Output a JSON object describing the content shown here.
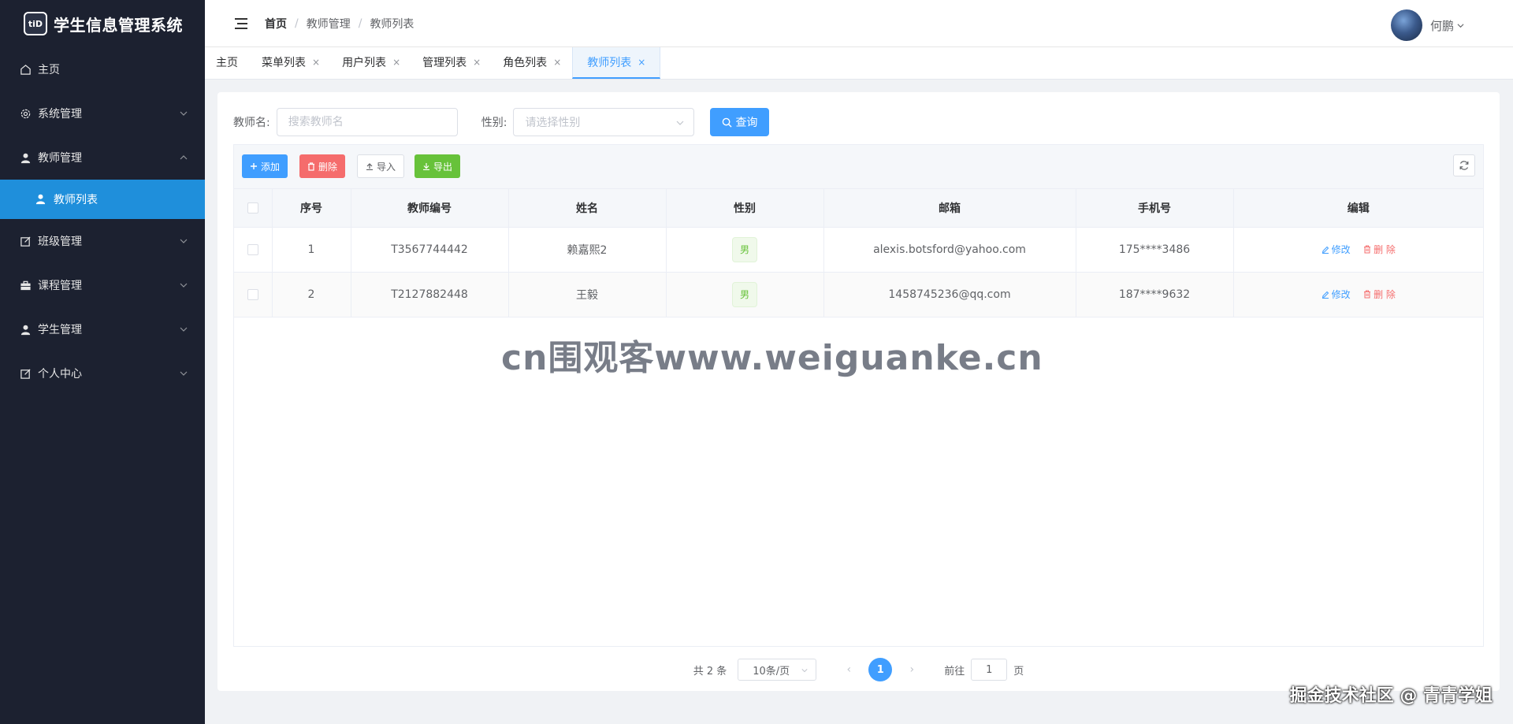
{
  "app": {
    "title": "学生信息管理系统",
    "logo_badge": "tiD"
  },
  "sidebar": {
    "items": [
      {
        "label": "主页",
        "icon": "home-icon"
      },
      {
        "label": "系统管理",
        "icon": "gear-icon"
      },
      {
        "label": "教师管理",
        "icon": "user-icon"
      },
      {
        "label": "教师列表",
        "icon": "user-icon"
      },
      {
        "label": "班级管理",
        "icon": "edit-icon"
      },
      {
        "label": "课程管理",
        "icon": "briefcase-icon"
      },
      {
        "label": "学生管理",
        "icon": "user-icon"
      },
      {
        "label": "个人中心",
        "icon": "edit-icon"
      }
    ]
  },
  "header": {
    "breadcrumb": [
      "首页",
      "教师管理",
      "教师列表"
    ],
    "breadcrumb_sep": "/",
    "user_name": "何鹏"
  },
  "tabs": [
    {
      "label": "主页",
      "closable": false
    },
    {
      "label": "菜单列表",
      "closable": true
    },
    {
      "label": "用户列表",
      "closable": true
    },
    {
      "label": "管理列表",
      "closable": true
    },
    {
      "label": "角色列表",
      "closable": true
    },
    {
      "label": "教师列表",
      "closable": true,
      "active": true
    }
  ],
  "tab_close_glyph": "×",
  "search": {
    "name_label": "教师名:",
    "name_placeholder": "搜索教师名",
    "gender_label": "性别:",
    "gender_placeholder": "请选择性别",
    "query_label": "查询"
  },
  "toolbar": {
    "add": "添加",
    "delete": "删除",
    "import": "导入",
    "export": "导出"
  },
  "table": {
    "columns": [
      "序号",
      "教师编号",
      "姓名",
      "性别",
      "邮箱",
      "手机号",
      "编辑"
    ],
    "rows": [
      {
        "index": "1",
        "teacher_no": "T3567744442",
        "name": "赖嘉熙2",
        "gender": "男",
        "email": "alexis.botsford@yahoo.com",
        "phone": "175****3486"
      },
      {
        "index": "2",
        "teacher_no": "T2127882448",
        "name": "王毅",
        "gender": "男",
        "email": "1458745236@qq.com",
        "phone": "187****9632"
      }
    ],
    "edit_label": "修改",
    "delete_label": "删 除"
  },
  "watermark": "cn围观客www.weiguanke.cn",
  "pagination": {
    "total": "共 2 条",
    "page_size": "10条/页",
    "current": "1",
    "goto_label": "前往",
    "goto_value": "1",
    "page_suffix": "页"
  },
  "credit": "掘金技术社区 @ 青青学姐",
  "colors": {
    "primary": "#409eff",
    "danger": "#f56c6c",
    "success": "#67c23a",
    "sidebar_bg": "#1c2130",
    "sidebar_active": "#1f8fdb"
  }
}
